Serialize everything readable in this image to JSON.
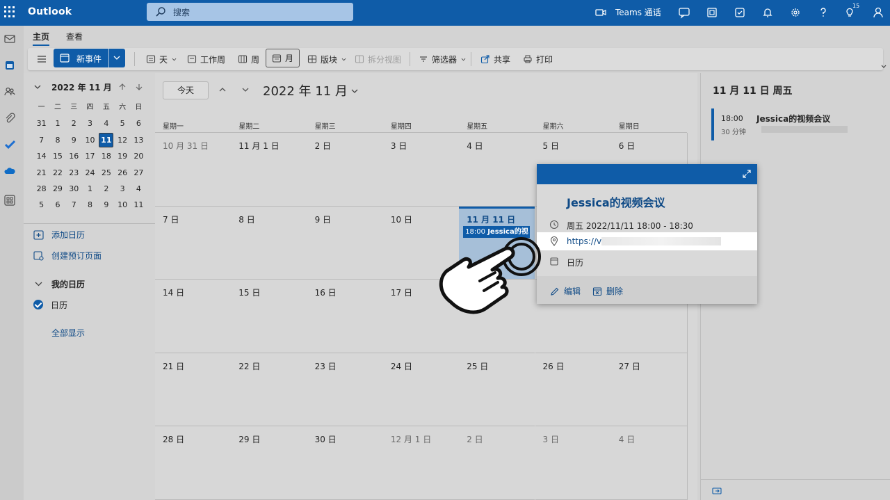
{
  "app": {
    "name": "Outlook"
  },
  "search": {
    "placeholder": "搜索"
  },
  "topbar": {
    "teams_label": "Teams 通话",
    "tips_badge": "15"
  },
  "ribbon": {
    "tabs": [
      {
        "label": "主页",
        "active": true
      },
      {
        "label": "查看",
        "active": false
      }
    ],
    "new_event": "新事件",
    "buttons": {
      "day": "天",
      "work_week": "工作周",
      "week": "周",
      "month": "月",
      "board": "版块",
      "split_view": "拆分视图",
      "filter": "筛选器",
      "share": "共享",
      "print": "打印"
    }
  },
  "mini_calendar": {
    "title": "2022 年 11 月",
    "weekdays": [
      "一",
      "二",
      "三",
      "四",
      "五",
      "六",
      "日"
    ],
    "weeks": [
      [
        "31",
        "1",
        "2",
        "3",
        "4",
        "5",
        "6"
      ],
      [
        "7",
        "8",
        "9",
        "10",
        "11",
        "12",
        "13"
      ],
      [
        "14",
        "15",
        "16",
        "17",
        "18",
        "19",
        "20"
      ],
      [
        "21",
        "22",
        "23",
        "24",
        "25",
        "26",
        "27"
      ],
      [
        "28",
        "29",
        "30",
        "1",
        "2",
        "3",
        "4"
      ],
      [
        "5",
        "6",
        "7",
        "8",
        "9",
        "10",
        "11"
      ]
    ],
    "today": "11"
  },
  "left_pane": {
    "add_calendar": "添加日历",
    "create_booking": "创建预订页面",
    "my_calendars": "我的日历",
    "calendar": "日历",
    "show_all": "全部显示"
  },
  "main": {
    "today_button": "今天",
    "month_title": "2022 年 11 月",
    "weekday_headers": [
      "星期一",
      "星期二",
      "星期三",
      "星期四",
      "星期五",
      "星期六",
      "星期日"
    ],
    "weeks": [
      [
        {
          "label": "10 月 31 日",
          "other": true
        },
        {
          "label": "11 月 1 日"
        },
        {
          "label": "2 日"
        },
        {
          "label": "3 日"
        },
        {
          "label": "4 日"
        },
        {
          "label": "5 日"
        },
        {
          "label": "6 日"
        }
      ],
      [
        {
          "label": "7 日"
        },
        {
          "label": "8 日"
        },
        {
          "label": "9 日"
        },
        {
          "label": "10 日"
        },
        {
          "label": "11 月 11 日",
          "today": true
        },
        {
          "label": ""
        },
        {
          "label": ""
        }
      ],
      [
        {
          "label": "14 日"
        },
        {
          "label": "15 日"
        },
        {
          "label": "16 日"
        },
        {
          "label": "17 日"
        },
        {
          "label": ""
        },
        {
          "label": ""
        },
        {
          "label": ""
        }
      ],
      [
        {
          "label": "21 日"
        },
        {
          "label": "22 日"
        },
        {
          "label": "23 日"
        },
        {
          "label": "24 日"
        },
        {
          "label": "25 日"
        },
        {
          "label": "26 日"
        },
        {
          "label": "27 日"
        }
      ],
      [
        {
          "label": "28 日"
        },
        {
          "label": "29 日"
        },
        {
          "label": "30 日"
        },
        {
          "label": "12 月 1 日",
          "other": true
        },
        {
          "label": "2 日",
          "other": true
        },
        {
          "label": "3 日",
          "other": true
        },
        {
          "label": "4 日",
          "other": true
        }
      ]
    ],
    "event_chip": {
      "time": "18:00",
      "title": "Jessica的视"
    }
  },
  "right_pane": {
    "date_title": "11 月 11 日 周五",
    "event": {
      "time": "18:00",
      "duration": "30 分钟",
      "title": "Jessica的视频会议"
    }
  },
  "popup": {
    "title": "Jessica的视频会议",
    "datetime": "周五 2022/11/11 18:00 - 18:30",
    "link": "https://v",
    "calendar": "日历",
    "edit": "编辑",
    "delete": "删除"
  },
  "colors": {
    "brand": "#0f5ca8"
  }
}
